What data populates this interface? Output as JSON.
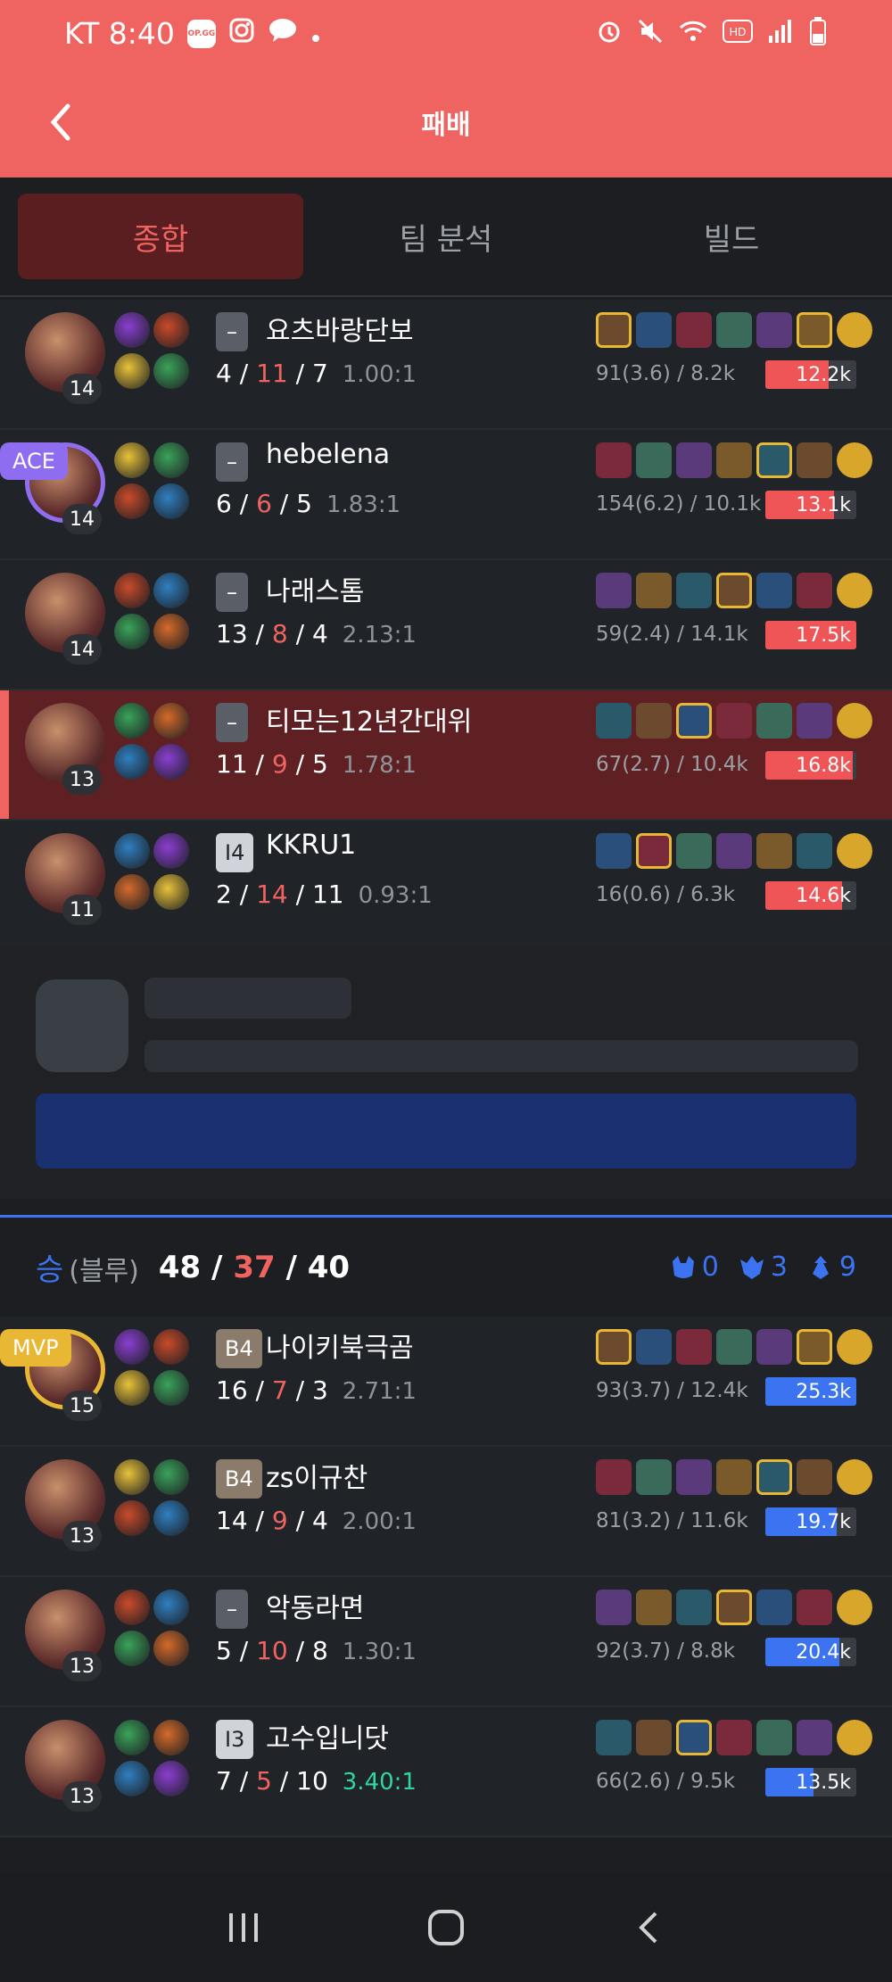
{
  "status_bar": {
    "time": "KT 8:40",
    "badge_text": "OP.GG"
  },
  "header": {
    "title": "패배"
  },
  "tabs": [
    {
      "label": "종합",
      "active": true
    },
    {
      "label": "팀 분석",
      "active": false
    },
    {
      "label": "빌드",
      "active": false
    }
  ],
  "team_red_rows": [
    {
      "level": "14",
      "tier": "–",
      "name": "요츠바랑단보",
      "k": "4",
      "d": "11",
      "a": "7",
      "ratio": "1.00:1",
      "cs": "91(3.6) / 8.2k",
      "damage": "12.2k",
      "damage_pct": 0.7,
      "mine": false,
      "badge": ""
    },
    {
      "level": "14",
      "tier": "–",
      "name": "hebelena",
      "k": "6",
      "d": "6",
      "a": "5",
      "ratio": "1.83:1",
      "cs": "154(6.2) / 10.1k",
      "damage": "13.1k",
      "damage_pct": 0.75,
      "mine": false,
      "badge": "ACE"
    },
    {
      "level": "14",
      "tier": "–",
      "name": "나래스톰",
      "k": "13",
      "d": "8",
      "a": "4",
      "ratio": "2.13:1",
      "cs": "59(2.4) / 14.1k",
      "damage": "17.5k",
      "damage_pct": 1.0,
      "mine": false,
      "badge": ""
    },
    {
      "level": "13",
      "tier": "–",
      "name": "티모는12년간대위",
      "k": "11",
      "d": "9",
      "a": "5",
      "ratio": "1.78:1",
      "cs": "67(2.7) / 10.4k",
      "damage": "16.8k",
      "damage_pct": 0.96,
      "mine": true,
      "badge": ""
    },
    {
      "level": "11",
      "tier": "I4",
      "name": "KKRU1",
      "k": "2",
      "d": "14",
      "a": "11",
      "ratio": "0.93:1",
      "cs": "16(0.6) / 6.3k",
      "damage": "14.6k",
      "damage_pct": 0.84,
      "mine": false,
      "badge": ""
    }
  ],
  "team_blue": {
    "result": "승",
    "side": "(블루)",
    "kills": "48",
    "deaths": "37",
    "assists": "40",
    "baron": "0",
    "dragon": "3",
    "tower": "9"
  },
  "team_blue_rows": [
    {
      "level": "15",
      "tier": "B4",
      "name": "나이키북극곰",
      "k": "16",
      "d": "7",
      "a": "3",
      "ratio": "2.71:1",
      "cs": "93(3.7) / 12.4k",
      "damage": "25.3k",
      "damage_pct": 1.0,
      "badge": "MVP"
    },
    {
      "level": "13",
      "tier": "B4",
      "name": "zs이규찬",
      "k": "14",
      "d": "9",
      "a": "4",
      "ratio": "2.00:1",
      "cs": "81(3.2) / 11.6k",
      "damage": "19.7k",
      "damage_pct": 0.78,
      "badge": ""
    },
    {
      "level": "13",
      "tier": "–",
      "name": "악동라면",
      "k": "5",
      "d": "10",
      "a": "8",
      "ratio": "1.30:1",
      "cs": "92(3.7) / 8.8k",
      "damage": "20.4k",
      "damage_pct": 0.81,
      "badge": ""
    },
    {
      "level": "13",
      "tier": "I3",
      "name": "고수입니닷",
      "k": "7",
      "d": "5",
      "a": "10",
      "ratio": "3.40:1",
      "cs": "66(2.6) / 9.5k",
      "damage": "13.5k",
      "damage_pct": 0.53,
      "badge": "",
      "ratio_green": true
    }
  ]
}
